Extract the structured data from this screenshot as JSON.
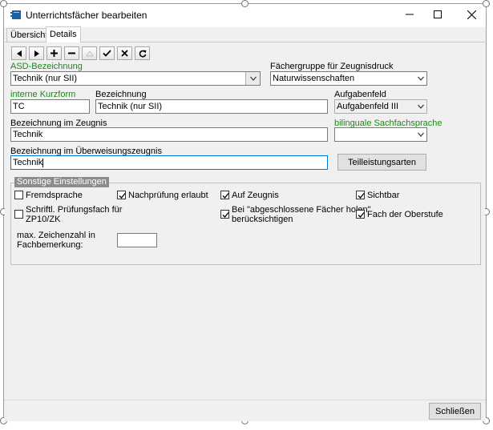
{
  "window": {
    "title": "Unterrichtsfächer bearbeiten"
  },
  "tabs": [
    {
      "label": "Übersicht"
    },
    {
      "label": "Details"
    }
  ],
  "toolbar": {
    "buttons": [
      "prev-icon",
      "next-icon",
      "add-icon",
      "remove-icon",
      "up-icon",
      "confirm-icon",
      "cancel-icon",
      "refresh-icon"
    ]
  },
  "form": {
    "asd_label": "ASD-Bezeichnung",
    "asd_value": "Technik (nur SII)",
    "faechergruppe_label": "Fächergruppe für Zeugnisdruck",
    "faechergruppe_value": "Naturwissenschaften",
    "kurzform_label": "interne Kurzform",
    "kurzform_value": "TC",
    "bezeichnung_label": "Bezeichnung",
    "bezeichnung_value": "Technik (nur SII)",
    "aufgabenfeld_label": "Aufgabenfeld",
    "aufgabenfeld_value": "Aufgabenfeld III",
    "zeugnis_label": "Bezeichnung im Zeugnis",
    "zeugnis_value": "Technik",
    "bilingual_label": "bilinguale Sachfachsprache",
    "bilingual_value": "",
    "ueberweisung_label": "Bezeichnung im Überweisungszeugnis",
    "ueberweisung_value": "Technik",
    "teilleistung_button": "Teilleistungsarten"
  },
  "settings": {
    "title": "Sonstige Einstellungen",
    "fremdsprache": {
      "label": "Fremdsprache",
      "checked": false
    },
    "nachpruefung": {
      "label": "Nachprüfung erlaubt",
      "checked": true
    },
    "auf_zeugnis": {
      "label": "Auf Zeugnis",
      "checked": true
    },
    "sichtbar": {
      "label": "Sichtbar",
      "checked": true
    },
    "schriftl_line1": "Schriftl. Prüfungsfach für",
    "schriftl_line2": "ZP10/ZK",
    "schriftl_checked": false,
    "abgeschlossen_line1": "Bei \"abgeschlossene Fächer holen\"",
    "abgeschlossen_line2": "berücksichtigen",
    "abgeschlossen_checked": true,
    "oberstufe": {
      "label": "Fach der Oberstufe",
      "checked": true
    },
    "max_zeichen_line1": "max. Zeichenzahl in",
    "max_zeichen_line2": "Fachbemerkung:",
    "max_zeichen_value": ""
  },
  "footer": {
    "close_button": "Schließen"
  },
  "colors": {
    "green_label": "#1a8a1a",
    "focus_border": "#0078d7",
    "title_icon": "#1e5fa8"
  }
}
